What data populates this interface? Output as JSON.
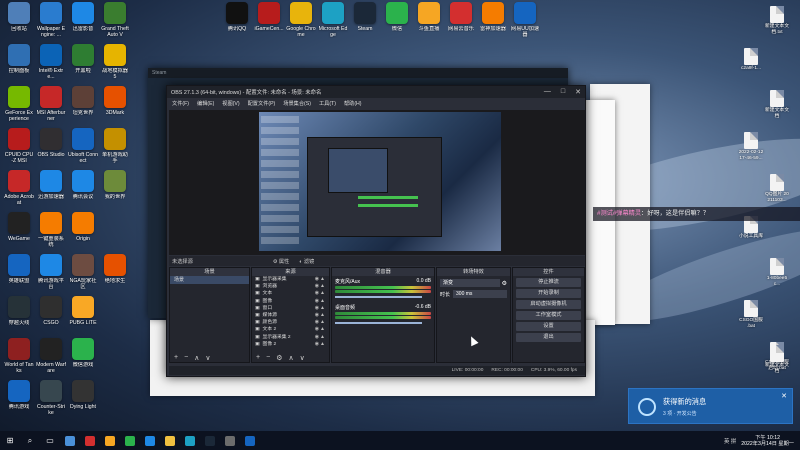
{
  "desktop": {
    "top_row": [
      {
        "label": "回收站",
        "icon": "recycle-bin-icon",
        "color": "#4f7fb8"
      },
      {
        "label": "Wallpaper Engine: ...",
        "icon": "wallpaper-engine-icon",
        "color": "#2a7ccf"
      },
      {
        "label": "迅雷影音",
        "icon": "xunlei-player-icon",
        "color": "#1e88e5"
      },
      {
        "label": "Grand Theft Auto V",
        "icon": "gta-icon",
        "color": "#3a7d2f"
      },
      {
        "label": "腾讯QQ",
        "icon": "qq-icon",
        "color": "#111111"
      },
      {
        "label": "iGameCen...",
        "icon": "igamecenter-icon",
        "color": "#b71c1c"
      },
      {
        "label": "Google Chrome",
        "icon": "chrome-icon",
        "color": "#e8b40c"
      },
      {
        "label": "Microsoft Edge",
        "icon": "edge-icon",
        "color": "#1da1c4"
      },
      {
        "label": "Steam",
        "icon": "steam-icon",
        "color": "#1b2838"
      },
      {
        "label": "微信",
        "icon": "wechat-icon",
        "color": "#2bb24c"
      },
      {
        "label": "斗鱼直播",
        "icon": "douyu-icon",
        "color": "#f6a623"
      },
      {
        "label": "网易云音乐",
        "icon": "netease-music-icon",
        "color": "#d32f2f"
      },
      {
        "label": "雷神加速器",
        "icon": "leishen-icon",
        "color": "#f57c00"
      },
      {
        "label": "网易UU加速器",
        "icon": "uu-accelerator-icon",
        "color": "#1565c0"
      }
    ],
    "left_columns": [
      [
        {
          "label": "控制面板",
          "icon": "control-panel-icon",
          "color": "#2f6fb3"
        },
        {
          "label": "GeForce Experience",
          "icon": "geforce-icon",
          "color": "#76b900"
        },
        {
          "label": "CPUID CPU-Z MSI",
          "icon": "cpuz-icon",
          "color": "#b71c1c"
        },
        {
          "label": "Adobe Acrobat",
          "icon": "acrobat-icon",
          "color": "#c62828"
        },
        {
          "label": "WeGame",
          "icon": "wegame-icon",
          "color": "#222222"
        },
        {
          "label": "英雄联盟",
          "icon": "lol-icon",
          "color": "#1565c0"
        },
        {
          "label": "穿越火线",
          "icon": "crossfire-icon",
          "color": "#263238"
        },
        {
          "label": "World of Tanks",
          "icon": "world-of-tanks-icon",
          "color": "#8e2020"
        },
        {
          "label": "腾讯游戏",
          "icon": "tencent-games-icon",
          "color": "#1565c0"
        }
      ],
      [
        {
          "label": "Intel® Extre...",
          "icon": "intel-icon",
          "color": "#0b63b6"
        },
        {
          "label": "MSI Afterburner",
          "icon": "afterburner-icon",
          "color": "#c62828"
        },
        {
          "label": "OBS Studio",
          "icon": "obs-icon",
          "color": "#302e31"
        },
        {
          "label": "迅游加速器",
          "icon": "xunyou-icon",
          "color": "#1e88e5"
        },
        {
          "label": "一键重装系统",
          "icon": "reinstall-icon",
          "color": "#f57c00"
        },
        {
          "label": "腾讯游戏平台",
          "icon": "tgp-icon",
          "color": "#1e88e5"
        },
        {
          "label": "CSGO",
          "icon": "csgo-icon",
          "color": "#2f2f2f"
        },
        {
          "label": "Modern Warfare",
          "icon": "modern-warfare-icon",
          "color": "#222222"
        },
        {
          "label": "Counter-Strike",
          "icon": "counter-strike-icon",
          "color": "#37474f"
        }
      ],
      [
        {
          "label": "开黑啦",
          "icon": "kaiheila-icon",
          "color": "#2e7d32"
        },
        {
          "label": "坦克世界",
          "icon": "tank-icon",
          "color": "#5d4037"
        },
        {
          "label": "Ubisoft Connect",
          "icon": "ubisoft-icon",
          "color": "#1565c0"
        },
        {
          "label": "腾讯会议",
          "icon": "tencent-meeting-icon",
          "color": "#1e88e5"
        },
        {
          "label": "Origin",
          "icon": "origin-icon",
          "color": "#f57c00"
        },
        {
          "label": "NGA玩家社区",
          "icon": "nga-icon",
          "color": "#6d4c41"
        },
        {
          "label": "PUBG LITE",
          "icon": "pubg-icon",
          "color": "#f9a825"
        },
        {
          "label": "微信游戏",
          "icon": "wechat-game-icon",
          "color": "#2bb24c"
        },
        {
          "label": "Dying Light",
          "icon": "dying-light-icon",
          "color": "#333333"
        }
      ],
      [
        {
          "label": "战地模拟器 5",
          "icon": "battlefield-icon",
          "color": "#e6b400"
        },
        {
          "label": "3DMark",
          "icon": "3dmark-icon",
          "color": "#e65100"
        },
        {
          "label": "单机游戏助手",
          "icon": "game-helper-icon",
          "color": "#c49000"
        },
        {
          "label": "我的世界",
          "icon": "minecraft-icon",
          "color": "#6d8b3a"
        },
        {
          "label": "",
          "icon": "",
          "color": ""
        },
        {
          "label": "绝地求生",
          "icon": "pubg-main-icon",
          "color": "#e65100"
        },
        {
          "label": "",
          "icon": "",
          "color": ""
        },
        {
          "label": "",
          "icon": "",
          "color": ""
        },
        {
          "label": "",
          "icon": "",
          "color": ""
        }
      ]
    ],
    "right_files": [
      {
        "label": "新建文本文档.txt"
      },
      {
        "label": "c2a9f-1..."
      },
      {
        "label": "新建文本文档"
      },
      {
        "label": "2022-02-12 17-46-59..."
      },
      {
        "label": "QQ图片 20211103..."
      },
      {
        "label": "小说工具库"
      },
      {
        "label": "1-80bee5c..."
      },
      {
        "label": "CSGO国服 .bat"
      },
      {
        "label": "CSGO国服 启动.bat"
      },
      {
        "label": "新建文本文档"
      }
    ]
  },
  "host_window": {
    "title_left": "Steam",
    "menu": [
      "文件(F)",
      "编辑(E)",
      "视图(V)",
      "场景集合(S)",
      "工具(T)",
      "帮助(H)"
    ]
  },
  "obs": {
    "title": "OBS 27.1.3 (64-bit, windows) - 配置文件: 未命名 - 场景: 未命名",
    "menu": [
      "文件(F)",
      "编辑(E)",
      "视图(V)",
      "配置文件(P)",
      "场景集合(S)",
      "工具(T)",
      "帮助(H)"
    ],
    "status_bar": {
      "no_source": "未选择源",
      "properties": "属性",
      "filters": "滤镜"
    },
    "docks": {
      "scenes": {
        "title": "场景",
        "items": [
          "场景"
        ]
      },
      "sources": {
        "title": "来源",
        "items": [
          "显示器采集",
          "浏览器",
          "文本",
          "图像",
          "窗口",
          "媒体源",
          "颜色源",
          "文本 2",
          "显示器采集 2",
          "图像 2"
        ]
      },
      "mixer": {
        "title": "混音器",
        "channels": [
          {
            "name": "麦克风/Aux",
            "level": "0.0 dB"
          },
          {
            "name": "桌面音频",
            "level": "-0.6 dB"
          }
        ]
      },
      "transitions": {
        "title": "转场特效",
        "type": "渐变",
        "duration_label": "时长",
        "duration": "300 ms"
      },
      "controls": {
        "title": "控件",
        "buttons": [
          "停止推流",
          "开始录制",
          "启动虚拟摄像机",
          "工作室模式",
          "设置",
          "退出"
        ]
      }
    },
    "footer": {
      "live": "LIVE: 00:00:00",
      "rec": "REC: 00:00:00",
      "cpu": "CPU: 3.9%, 60.00 fps"
    }
  },
  "chat_overlay": {
    "user": "#测试#弹幕精灵",
    "message": "：好呀，这是伴侣嘛？？"
  },
  "notification": {
    "title": "获得新的消息",
    "subtitle": "3 项 · 开发公告"
  },
  "taskbar": {
    "apps": [
      "windows-start",
      "search",
      "task-view",
      "chrome",
      "netease-music",
      "douyu",
      "wechat",
      "qq",
      "explorer",
      "edge",
      "steam",
      "obs",
      "uu"
    ],
    "tray_text": "英 拼",
    "clock_time": "下午 10:12",
    "clock_date": "2022年3月14日 星期一"
  },
  "colors": {
    "obs_bg": "#2b2e38",
    "taskbar_bg": "#0c1220",
    "toast_bg": "#1e5fa6"
  }
}
